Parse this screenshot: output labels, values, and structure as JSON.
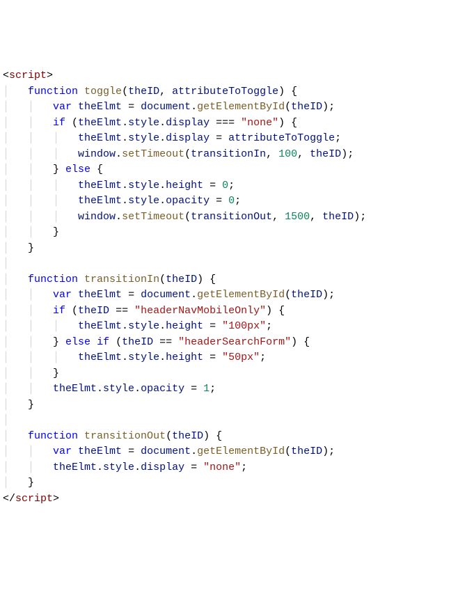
{
  "lines": [
    {
      "guides": "",
      "tokens": [
        {
          "c": "punc",
          "t": "<"
        },
        {
          "c": "tag",
          "t": "script"
        },
        {
          "c": "punc",
          "t": ">"
        }
      ]
    },
    {
      "guides": "│   ",
      "tokens": [
        {
          "c": "kw",
          "t": "function"
        },
        {
          "c": "punc",
          "t": " "
        },
        {
          "c": "fn",
          "t": "toggle"
        },
        {
          "c": "punc",
          "t": "("
        },
        {
          "c": "var",
          "t": "theID"
        },
        {
          "c": "punc",
          "t": ", "
        },
        {
          "c": "var",
          "t": "attributeToToggle"
        },
        {
          "c": "punc",
          "t": ") {"
        }
      ]
    },
    {
      "guides": "│   │   ",
      "tokens": [
        {
          "c": "kw",
          "t": "var"
        },
        {
          "c": "punc",
          "t": " "
        },
        {
          "c": "var",
          "t": "theElmt"
        },
        {
          "c": "punc",
          "t": " = "
        },
        {
          "c": "var",
          "t": "document"
        },
        {
          "c": "punc",
          "t": "."
        },
        {
          "c": "fn",
          "t": "getElementById"
        },
        {
          "c": "punc",
          "t": "("
        },
        {
          "c": "var",
          "t": "theID"
        },
        {
          "c": "punc",
          "t": ");"
        }
      ]
    },
    {
      "guides": "│   │   ",
      "tokens": [
        {
          "c": "kw",
          "t": "if"
        },
        {
          "c": "punc",
          "t": " ("
        },
        {
          "c": "var",
          "t": "theElmt"
        },
        {
          "c": "punc",
          "t": "."
        },
        {
          "c": "var",
          "t": "style"
        },
        {
          "c": "punc",
          "t": "."
        },
        {
          "c": "var",
          "t": "display"
        },
        {
          "c": "punc",
          "t": " === "
        },
        {
          "c": "str",
          "t": "\"none\""
        },
        {
          "c": "punc",
          "t": ") {"
        }
      ]
    },
    {
      "guides": "│   │   │   ",
      "tokens": [
        {
          "c": "var",
          "t": "theElmt"
        },
        {
          "c": "punc",
          "t": "."
        },
        {
          "c": "var",
          "t": "style"
        },
        {
          "c": "punc",
          "t": "."
        },
        {
          "c": "var",
          "t": "display"
        },
        {
          "c": "punc",
          "t": " = "
        },
        {
          "c": "var",
          "t": "attributeToToggle"
        },
        {
          "c": "punc",
          "t": ";"
        }
      ]
    },
    {
      "guides": "│   │   │   ",
      "tokens": [
        {
          "c": "var",
          "t": "window"
        },
        {
          "c": "punc",
          "t": "."
        },
        {
          "c": "fn",
          "t": "setTimeout"
        },
        {
          "c": "punc",
          "t": "("
        },
        {
          "c": "var",
          "t": "transitionIn"
        },
        {
          "c": "punc",
          "t": ", "
        },
        {
          "c": "num",
          "t": "100"
        },
        {
          "c": "punc",
          "t": ", "
        },
        {
          "c": "var",
          "t": "theID"
        },
        {
          "c": "punc",
          "t": ");"
        }
      ]
    },
    {
      "guides": "│   │   ",
      "tokens": [
        {
          "c": "punc",
          "t": "} "
        },
        {
          "c": "kw",
          "t": "else"
        },
        {
          "c": "punc",
          "t": " {"
        }
      ]
    },
    {
      "guides": "│   │   │   ",
      "tokens": [
        {
          "c": "var",
          "t": "theElmt"
        },
        {
          "c": "punc",
          "t": "."
        },
        {
          "c": "var",
          "t": "style"
        },
        {
          "c": "punc",
          "t": "."
        },
        {
          "c": "var",
          "t": "height"
        },
        {
          "c": "punc",
          "t": " = "
        },
        {
          "c": "num",
          "t": "0"
        },
        {
          "c": "punc",
          "t": ";"
        }
      ]
    },
    {
      "guides": "│   │   │   ",
      "tokens": [
        {
          "c": "var",
          "t": "theElmt"
        },
        {
          "c": "punc",
          "t": "."
        },
        {
          "c": "var",
          "t": "style"
        },
        {
          "c": "punc",
          "t": "."
        },
        {
          "c": "var",
          "t": "opacity"
        },
        {
          "c": "punc",
          "t": " = "
        },
        {
          "c": "num",
          "t": "0"
        },
        {
          "c": "punc",
          "t": ";"
        }
      ]
    },
    {
      "guides": "│   │   │   ",
      "tokens": [
        {
          "c": "var",
          "t": "window"
        },
        {
          "c": "punc",
          "t": "."
        },
        {
          "c": "fn",
          "t": "setTimeout"
        },
        {
          "c": "punc",
          "t": "("
        },
        {
          "c": "var",
          "t": "transitionOut"
        },
        {
          "c": "punc",
          "t": ", "
        },
        {
          "c": "num",
          "t": "1500"
        },
        {
          "c": "punc",
          "t": ", "
        },
        {
          "c": "var",
          "t": "theID"
        },
        {
          "c": "punc",
          "t": ");"
        }
      ]
    },
    {
      "guides": "│   │   ",
      "tokens": [
        {
          "c": "punc",
          "t": "}"
        }
      ]
    },
    {
      "guides": "│   ",
      "tokens": [
        {
          "c": "punc",
          "t": "}"
        }
      ]
    },
    {
      "guides": "│   ",
      "tokens": []
    },
    {
      "guides": "│   ",
      "tokens": [
        {
          "c": "kw",
          "t": "function"
        },
        {
          "c": "punc",
          "t": " "
        },
        {
          "c": "fn",
          "t": "transitionIn"
        },
        {
          "c": "punc",
          "t": "("
        },
        {
          "c": "var",
          "t": "theID"
        },
        {
          "c": "punc",
          "t": ") {"
        }
      ]
    },
    {
      "guides": "│   │   ",
      "tokens": [
        {
          "c": "kw",
          "t": "var"
        },
        {
          "c": "punc",
          "t": " "
        },
        {
          "c": "var",
          "t": "theElmt"
        },
        {
          "c": "punc",
          "t": " = "
        },
        {
          "c": "var",
          "t": "document"
        },
        {
          "c": "punc",
          "t": "."
        },
        {
          "c": "fn",
          "t": "getElementById"
        },
        {
          "c": "punc",
          "t": "("
        },
        {
          "c": "var",
          "t": "theID"
        },
        {
          "c": "punc",
          "t": ");"
        }
      ]
    },
    {
      "guides": "│   │   ",
      "tokens": [
        {
          "c": "kw",
          "t": "if"
        },
        {
          "c": "punc",
          "t": " ("
        },
        {
          "c": "var",
          "t": "theID"
        },
        {
          "c": "punc",
          "t": " == "
        },
        {
          "c": "str",
          "t": "\"headerNavMobileOnly\""
        },
        {
          "c": "punc",
          "t": ") {"
        }
      ]
    },
    {
      "guides": "│   │   │   ",
      "tokens": [
        {
          "c": "var",
          "t": "theElmt"
        },
        {
          "c": "punc",
          "t": "."
        },
        {
          "c": "var",
          "t": "style"
        },
        {
          "c": "punc",
          "t": "."
        },
        {
          "c": "var",
          "t": "height"
        },
        {
          "c": "punc",
          "t": " = "
        },
        {
          "c": "str",
          "t": "\"100px\""
        },
        {
          "c": "punc",
          "t": ";"
        }
      ]
    },
    {
      "guides": "│   │   ",
      "tokens": [
        {
          "c": "punc",
          "t": "} "
        },
        {
          "c": "kw",
          "t": "else"
        },
        {
          "c": "punc",
          "t": " "
        },
        {
          "c": "kw",
          "t": "if"
        },
        {
          "c": "punc",
          "t": " ("
        },
        {
          "c": "var",
          "t": "theID"
        },
        {
          "c": "punc",
          "t": " == "
        },
        {
          "c": "str",
          "t": "\"headerSearchForm\""
        },
        {
          "c": "punc",
          "t": ") {"
        }
      ]
    },
    {
      "guides": "│   │   │   ",
      "tokens": [
        {
          "c": "var",
          "t": "theElmt"
        },
        {
          "c": "punc",
          "t": "."
        },
        {
          "c": "var",
          "t": "style"
        },
        {
          "c": "punc",
          "t": "."
        },
        {
          "c": "var",
          "t": "height"
        },
        {
          "c": "punc",
          "t": " = "
        },
        {
          "c": "str",
          "t": "\"50px\""
        },
        {
          "c": "punc",
          "t": ";"
        }
      ]
    },
    {
      "guides": "│   │   ",
      "tokens": [
        {
          "c": "punc",
          "t": "}"
        }
      ]
    },
    {
      "guides": "│   │   ",
      "tokens": [
        {
          "c": "var",
          "t": "theElmt"
        },
        {
          "c": "punc",
          "t": "."
        },
        {
          "c": "var",
          "t": "style"
        },
        {
          "c": "punc",
          "t": "."
        },
        {
          "c": "var",
          "t": "opacity"
        },
        {
          "c": "punc",
          "t": " = "
        },
        {
          "c": "num",
          "t": "1"
        },
        {
          "c": "punc",
          "t": ";"
        }
      ]
    },
    {
      "guides": "│   ",
      "tokens": [
        {
          "c": "punc",
          "t": "}"
        }
      ]
    },
    {
      "guides": "│   ",
      "tokens": []
    },
    {
      "guides": "│   ",
      "tokens": [
        {
          "c": "kw",
          "t": "function"
        },
        {
          "c": "punc",
          "t": " "
        },
        {
          "c": "fn",
          "t": "transitionOut"
        },
        {
          "c": "punc",
          "t": "("
        },
        {
          "c": "var",
          "t": "theID"
        },
        {
          "c": "punc",
          "t": ") {"
        }
      ]
    },
    {
      "guides": "│   │   ",
      "tokens": [
        {
          "c": "kw",
          "t": "var"
        },
        {
          "c": "punc",
          "t": " "
        },
        {
          "c": "var",
          "t": "theElmt"
        },
        {
          "c": "punc",
          "t": " = "
        },
        {
          "c": "var",
          "t": "document"
        },
        {
          "c": "punc",
          "t": "."
        },
        {
          "c": "fn",
          "t": "getElementById"
        },
        {
          "c": "punc",
          "t": "("
        },
        {
          "c": "var",
          "t": "theID"
        },
        {
          "c": "punc",
          "t": ");"
        }
      ]
    },
    {
      "guides": "│   │   ",
      "tokens": [
        {
          "c": "var",
          "t": "theElmt"
        },
        {
          "c": "punc",
          "t": "."
        },
        {
          "c": "var",
          "t": "style"
        },
        {
          "c": "punc",
          "t": "."
        },
        {
          "c": "var",
          "t": "display"
        },
        {
          "c": "punc",
          "t": " = "
        },
        {
          "c": "str",
          "t": "\"none\""
        },
        {
          "c": "punc",
          "t": ";"
        }
      ]
    },
    {
      "guides": "│   ",
      "tokens": [
        {
          "c": "punc",
          "t": "}"
        }
      ]
    },
    {
      "guides": "",
      "tokens": [
        {
          "c": "punc",
          "t": "</"
        },
        {
          "c": "tag",
          "t": "script"
        },
        {
          "c": "punc",
          "t": ">"
        }
      ]
    }
  ]
}
